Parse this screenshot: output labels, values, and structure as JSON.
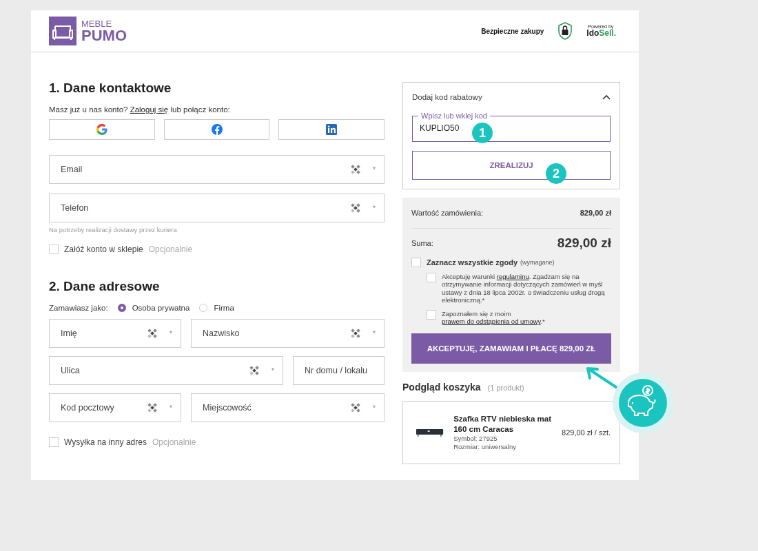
{
  "header": {
    "logo_top": "MEBLE",
    "logo_bottom": "PUMO",
    "secure": "Bezpieczne zakupy",
    "powered_by": "Powered by",
    "brand_a": "Ido",
    "brand_b": "Sell."
  },
  "contact": {
    "title": "1. Dane kontaktowe",
    "login_before": "Masz już u nas konto? ",
    "login_link": "Zaloguj się",
    "login_after": " lub połącz konto:",
    "social": [
      {
        "kind": "google"
      },
      {
        "kind": "facebook"
      },
      {
        "kind": "linkedin"
      }
    ],
    "fields": [
      {
        "placeholder": "Email",
        "autofill": true,
        "mark": "*"
      },
      {
        "placeholder": "Telefon",
        "autofill": true,
        "mark": "*"
      }
    ],
    "hint": "Na potrzeby realizacji dostawy przez kuriera",
    "account": {
      "label": "Załóż konto w sklepie",
      "note": "Opcjonalnie",
      "checked": false
    }
  },
  "address": {
    "title": "2. Dane adresowe",
    "as_label": "Zamawiasz jako:",
    "types": [
      {
        "label": "Osoba prywatna",
        "selected": true
      },
      {
        "label": "Firma",
        "selected": false
      }
    ],
    "rows": [
      [
        {
          "placeholder": "Imię",
          "autofill": true,
          "mark": "*"
        },
        {
          "placeholder": "Nazwisko",
          "autofill": true,
          "mark": "*"
        }
      ],
      [
        {
          "placeholder": "Ulica",
          "autofill": true,
          "mark": "*"
        },
        {
          "placeholder": "Nr domu / lokalu",
          "autofill": false
        }
      ],
      [
        {
          "placeholder": "Kod pocztowy",
          "autofill": true,
          "mark": "*"
        },
        {
          "placeholder": "Miejscowość",
          "autofill": true,
          "mark": "*"
        }
      ]
    ],
    "other": {
      "label": "Wysyłka na inny adres",
      "note": "Opcjonalnie",
      "checked": false
    }
  },
  "coupon": {
    "title": "Dodaj kod rabatowy",
    "expanded": true,
    "legend": "Wpisz lub wklej kod",
    "value": "KUPLIO50",
    "button": "ZREALIZUJ"
  },
  "summary": {
    "rows": [
      {
        "label": "Wartość zamówienia:",
        "value": "829,00 zł"
      },
      {
        "label": "Suma:",
        "value": "829,00 zł"
      }
    ],
    "all": {
      "label": "Zaznacz wszystkie zgody",
      "note": "(wymagane)",
      "checked": false
    },
    "consents": [
      {
        "checked": false,
        "before": "Akceptuję warunki ",
        "link": "regulaminu",
        "after": ". Zgadzam się na otrzymywanie informacji dotyczących zamówień w myśl ustawy z dnia 18 lipca 2002r. o świadczeniu usług drogą elektroniczną.*"
      },
      {
        "checked": false,
        "before": "Zapoznałem się z moim ",
        "link": "prawem do odstąpienia od umowy",
        "after": ".*"
      }
    ],
    "button": "AKCEPTUJĘ, ZAMAWIAM I PŁACĘ 829,00 ZŁ"
  },
  "cart": {
    "title": "Podgląd koszyka",
    "count": "(1 produkt)",
    "items": [
      {
        "name": "Szafka RTV niebieska mat 160 cm Caracas",
        "symbol": "Symbol: 27925",
        "size": "Rozmiar: uniwersalny",
        "price": "829,00 zł / szt."
      }
    ]
  },
  "callouts": [
    "1",
    "2"
  ]
}
